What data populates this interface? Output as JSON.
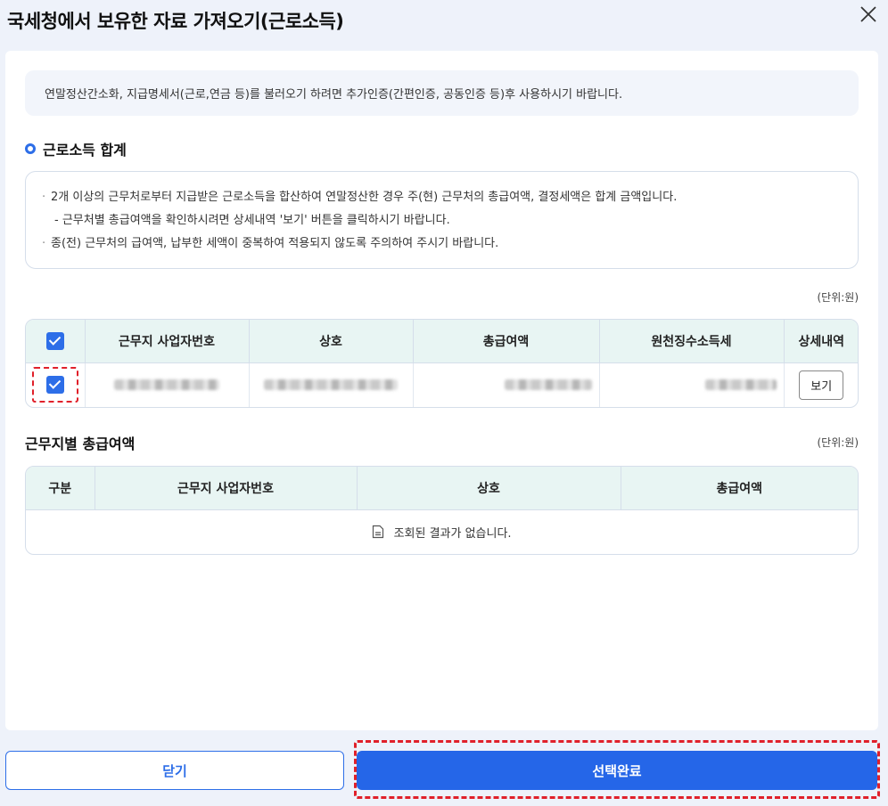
{
  "dialog": {
    "title": "국세청에서 보유한 자료 가져오기(근로소득)"
  },
  "notice": "연말정산간소화, 지급명세서(근로,연금 등)를 불러오기 하려면 추가인증(간편인증, 공동인증 등)후 사용하시기 바랍니다.",
  "summary": {
    "title": "근로소득 합계",
    "info": [
      "2개 이상의 근무처로부터 지급받은 근로소득을 합산하여 연말정산한 경우 주(현) 근무처의 총급여액, 결정세액은 합계 금액입니다.",
      "- 근무처별 총급여액을 확인하시려면 상세내역 '보기' 버튼을 클릭하시기 바랍니다.",
      "종(전) 근무처의 급여액, 납부한 세액이 중복하여 적용되지 않도록 주의하여 주시기 바랍니다."
    ],
    "unit": "(단위:원)",
    "columns": [
      "근무지 사업자번호",
      "상호",
      "총급여액",
      "원천징수소득세",
      "상세내역"
    ],
    "rows": [
      {
        "view_label": "보기"
      }
    ]
  },
  "by_workplace": {
    "title": "근무지별 총급여액",
    "unit": "(단위:원)",
    "columns": [
      "구분",
      "근무지 사업자번호",
      "상호",
      "총급여액"
    ],
    "empty_text": "조회된 결과가 없습니다."
  },
  "footer": {
    "close_label": "닫기",
    "confirm_label": "선택완료"
  },
  "colors": {
    "accent": "#2566e8",
    "header_bg": "#e8f5f3",
    "highlight": "#e0202a"
  }
}
